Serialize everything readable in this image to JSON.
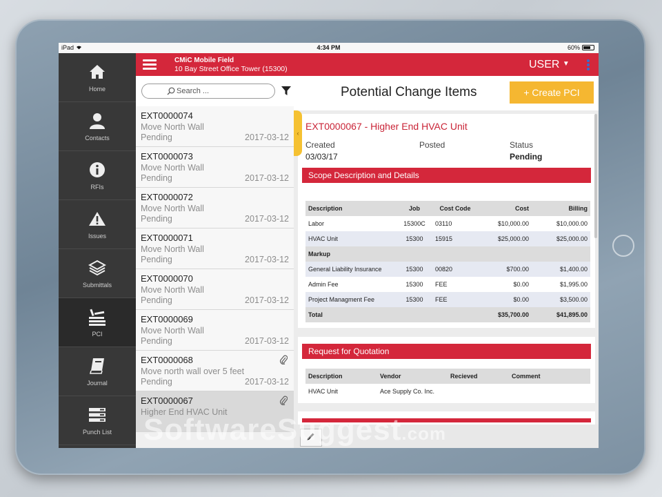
{
  "status_bar": {
    "device": "iPad",
    "time": "4:34 PM",
    "battery": "60%"
  },
  "header": {
    "app_title": "CMiC Mobile Field",
    "project": "10 Bay Street Office Tower (15300)",
    "user_label": "USER"
  },
  "sidebar": {
    "items": [
      {
        "label": "Home",
        "icon": "home-icon"
      },
      {
        "label": "Contacts",
        "icon": "person-icon"
      },
      {
        "label": "RFIs",
        "icon": "info-icon"
      },
      {
        "label": "Issues",
        "icon": "warning-icon"
      },
      {
        "label": "Submittals",
        "icon": "layers-icon"
      },
      {
        "label": "PCI",
        "icon": "stack-icon"
      },
      {
        "label": "Journal",
        "icon": "book-icon"
      },
      {
        "label": "Punch List",
        "icon": "list-icon"
      }
    ]
  },
  "search": {
    "placeholder": "Search ..."
  },
  "list": {
    "items": [
      {
        "id": "EXT0000074",
        "desc": "Move North Wall",
        "status": "Pending",
        "date": "2017-03-12",
        "attachment": false
      },
      {
        "id": "EXT0000073",
        "desc": "Move North Wall",
        "status": "Pending",
        "date": "2017-03-12",
        "attachment": false
      },
      {
        "id": "EXT0000072",
        "desc": "Move North Wall",
        "status": "Pending",
        "date": "2017-03-12",
        "attachment": false
      },
      {
        "id": "EXT0000071",
        "desc": "Move North Wall",
        "status": "Pending",
        "date": "2017-03-12",
        "attachment": false
      },
      {
        "id": "EXT0000070",
        "desc": "Move North Wall",
        "status": "Pending",
        "date": "2017-03-12",
        "attachment": false
      },
      {
        "id": "EXT0000069",
        "desc": "Move North Wall",
        "status": "Pending",
        "date": "2017-03-12",
        "attachment": false
      },
      {
        "id": "EXT0000068",
        "desc": "Move north wall over 5 feet",
        "status": "Pending",
        "date": "2017-03-12",
        "attachment": true
      },
      {
        "id": "EXT0000067",
        "desc": "Higher End HVAC Unit",
        "status": "",
        "date": "",
        "attachment": true
      }
    ]
  },
  "detail": {
    "page_title": "Potential Change Items",
    "create_label": "+ Create PCI",
    "ref_title": "EXT0000067 - Higher End HVAC Unit",
    "created_label": "Created",
    "created_value": "03/03/17",
    "posted_label": "Posted",
    "status_label": "Status",
    "status_value": "Pending",
    "scope_title": "Scope Description and Details",
    "scope_headers": [
      "Description",
      "Job",
      "Cost Code",
      "Cost",
      "Billing"
    ],
    "scope_rows": [
      {
        "desc": "Labor",
        "job": "15300C",
        "code": "03110",
        "cost": "$10,000.00",
        "billing": "$10,000.00",
        "kind": "normal"
      },
      {
        "desc": "HVAC Unit",
        "job": "15300",
        "code": "15915",
        "cost": "$25,000.00",
        "billing": "$25,000.00",
        "kind": "alt"
      },
      {
        "desc": "Markup",
        "job": "",
        "code": "",
        "cost": "",
        "billing": "",
        "kind": "section"
      },
      {
        "desc": "General Liability Insurance",
        "job": "15300",
        "code": "00820",
        "cost": "$700.00",
        "billing": "$1,400.00",
        "kind": "alt"
      },
      {
        "desc": "Admin Fee",
        "job": "15300",
        "code": "FEE",
        "cost": "$0.00",
        "billing": "$1,995.00",
        "kind": "normal"
      },
      {
        "desc": "Project Managment Fee",
        "job": "15300",
        "code": "FEE",
        "cost": "$0.00",
        "billing": "$3,500.00",
        "kind": "alt"
      },
      {
        "desc": "Total",
        "job": "",
        "code": "",
        "cost": "$35,700.00",
        "billing": "$41,895.00",
        "kind": "total"
      }
    ],
    "rfq_title": "Request for Quotation",
    "rfq_headers": [
      "Description",
      "Vendor",
      "Recieved",
      "Comment"
    ],
    "rfq_rows": [
      {
        "desc": "HVAC Unit",
        "vendor": "Ace Supply Co. Inc.",
        "received": "",
        "comment": ""
      }
    ]
  },
  "watermark": {
    "brand": "SoftwareSuggest",
    "suffix": ".com"
  },
  "colors": {
    "brand_red": "#d4273b",
    "accent_yellow": "#f5b731",
    "sidebar_bg": "#383838"
  }
}
